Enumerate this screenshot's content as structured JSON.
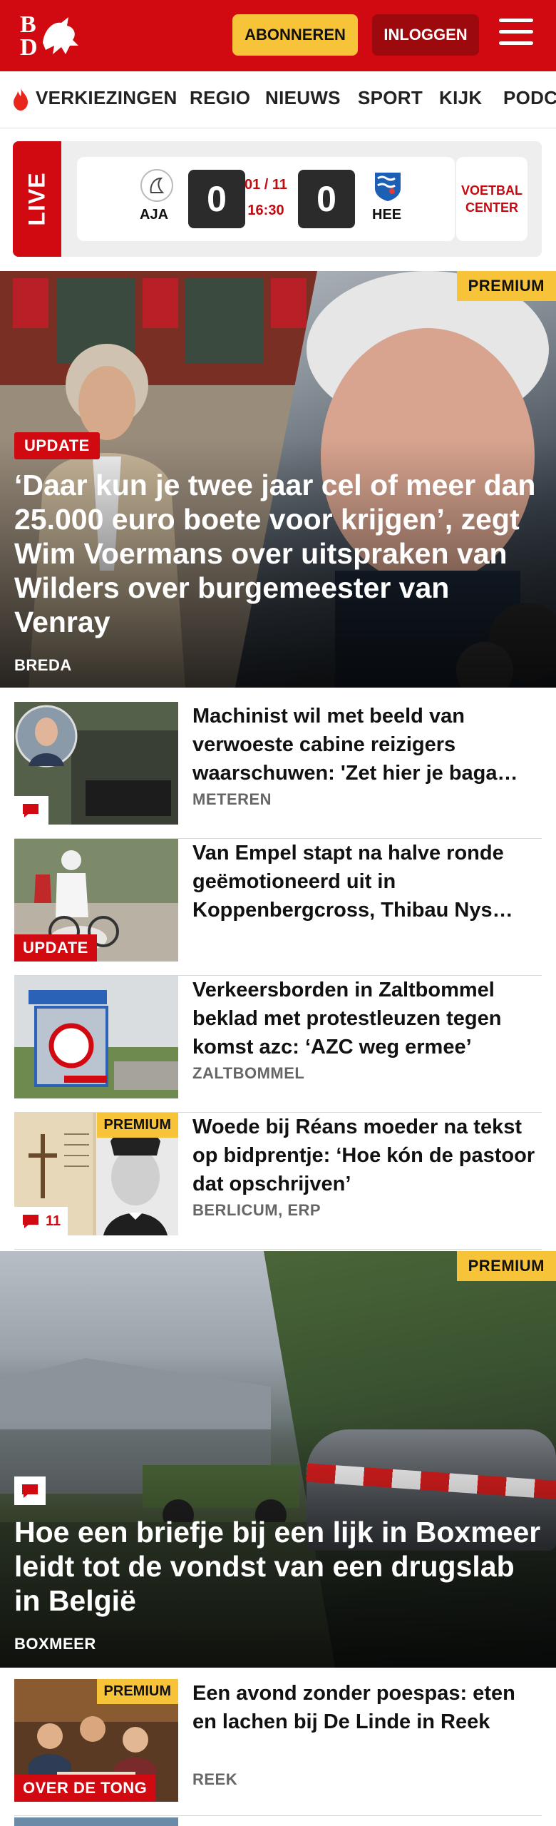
{
  "header": {
    "logo_top": "B",
    "logo_bottom": "D",
    "subscribe_label": "ABONNEREN",
    "login_label": "INLOGGEN",
    "menu_icon": "hamburger-icon",
    "brand_color": "#d10a11",
    "accent_color": "#f7c439"
  },
  "nav": {
    "items": [
      {
        "label": "VERKIEZINGEN",
        "icon": "flame-icon"
      },
      {
        "label": "REGIO"
      },
      {
        "label": "NIEUWS"
      },
      {
        "label": "SPORT"
      },
      {
        "label": "KIJK"
      },
      {
        "label": "PODC"
      }
    ]
  },
  "live": {
    "label": "LIVE",
    "home_team": "AJA",
    "away_team": "HEE",
    "home_score": "0",
    "away_score": "0",
    "date": "01 / 11",
    "time": "16:30",
    "voetbal_center": "VOETBAL CENTER"
  },
  "hero": {
    "premium": "PREMIUM",
    "tag": "UPDATE",
    "title": "‘Daar kun je twee jaar cel of meer dan 25.000 euro boete voor krijgen’, zegt Wim Voermans over uitspraken van Wilders over burgemeester van Venray",
    "location": "BREDA"
  },
  "articles": [
    {
      "title": "Machinist wil met beeld van verwoeste cabine reizigers waarschuwen: 'Zet hier je baga…",
      "location": "METEREN",
      "badge": "comment",
      "comment_count": ""
    },
    {
      "title": "Van Empel stapt na halve ronde geëmotioneerd uit in Koppenbergcross, Thibau Nys…",
      "location": "",
      "tag": "UPDATE"
    },
    {
      "title": "Verkeersborden in Zaltbommel beklad met protestleuzen tegen komst azc: ‘AZC weg ermee’",
      "location": "ZALTBOMMEL"
    },
    {
      "title": "Woede bij Réans moeder na tekst op bidprentje: ‘Hoe kón de pastoor dat opschrijven’",
      "location": "BERLICUM, ERP",
      "premium": "PREMIUM",
      "comment_count": "11"
    }
  ],
  "hero2": {
    "premium": "PREMIUM",
    "title": "Hoe een briefje bij een lijk in Boxmeer leidt tot de vondst van een drugslab in België",
    "location": "BOXMEER"
  },
  "last_article": {
    "title": "Een avond zonder poespas: eten en lachen bij De Linde in Reek",
    "location": "REEK",
    "premium": "PREMIUM",
    "tag": "OVER DE TONG"
  }
}
